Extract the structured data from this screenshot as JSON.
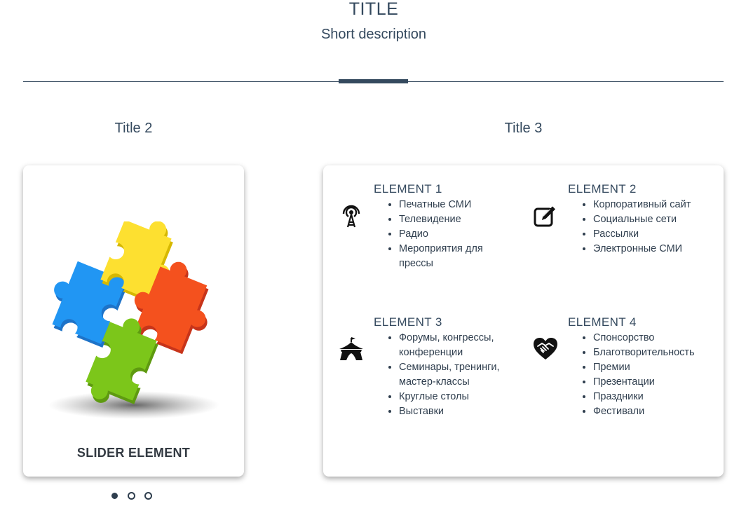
{
  "header": {
    "title": "TITLE",
    "description": "Short description"
  },
  "sections": {
    "left_title": "Title 2",
    "right_title": "Title 3"
  },
  "slider": {
    "caption": "SLIDER ELEMENT",
    "image": "puzzle-pieces",
    "dots": [
      {
        "active": true
      },
      {
        "active": false
      },
      {
        "active": false
      }
    ]
  },
  "elements": [
    {
      "title": "ELEMENT 1",
      "icon": "radio-tower-icon",
      "items": [
        "Печатные СМИ",
        "Телевидение",
        "Радио",
        "Мероприятия для прессы"
      ]
    },
    {
      "title": "ELEMENT 2",
      "icon": "edit-icon",
      "items": [
        "Корпоративный сайт",
        "Социальные сети",
        "Рассылки",
        "Электронные СМИ"
      ]
    },
    {
      "title": "ELEMENT 3",
      "icon": "tent-icon",
      "items": [
        "Форумы, конгрессы, конференции",
        "Семинары, тренинги, мастер-классы",
        "Круглые столы",
        "Выставки"
      ]
    },
    {
      "title": "ELEMENT 4",
      "icon": "handshake-heart-icon",
      "items": [
        "Спонсорство",
        "Благотворительность",
        "Премии",
        "Презентации",
        "Праздники",
        "Фестивали"
      ]
    }
  ]
}
